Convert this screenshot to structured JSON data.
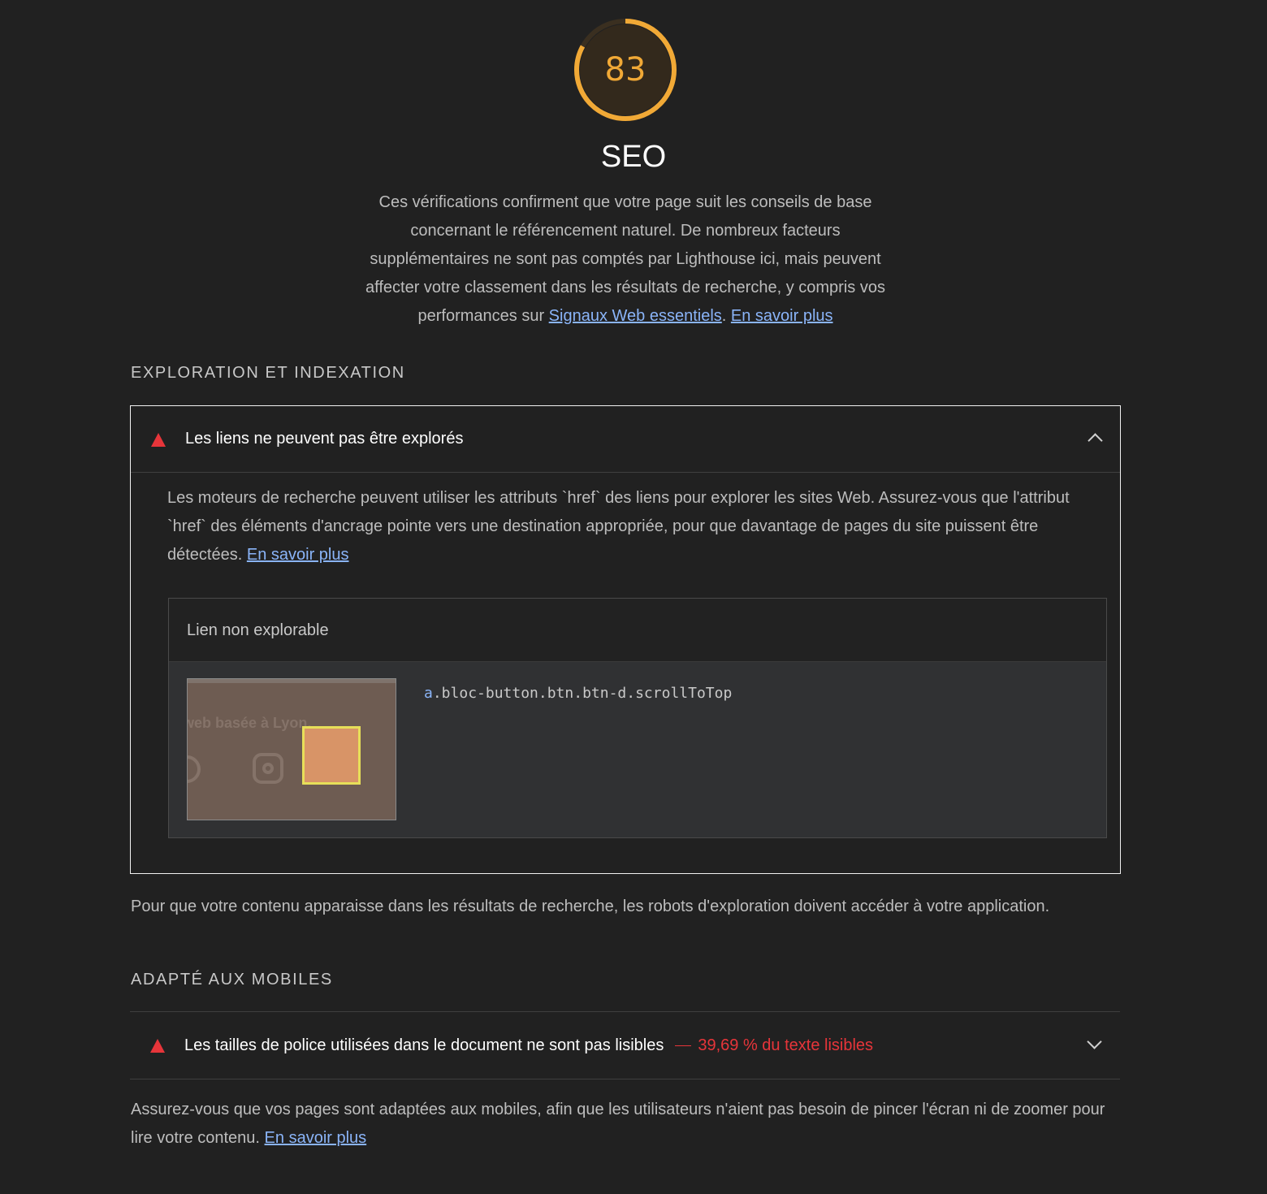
{
  "category": {
    "score": "83",
    "score_fraction": 0.83,
    "score_color": "#f1a936",
    "title": "SEO",
    "description_text": "Ces vérifications confirment que votre page suit les conseils de base concernant le référencement naturel. De nombreux facteurs supplémentaires ne sont pas comptés par Lighthouse ici, mais peuvent affecter votre classement dans les résultats de recherche, y compris vos performances sur",
    "cwv_link": "Signaux Web essentiels",
    "separator": ".",
    "learn_more": "En savoir plus"
  },
  "groups": {
    "crawl": {
      "title": "EXPLORATION ET INDEXATION",
      "audit": {
        "icon": "fail-triangle-icon",
        "title": "Les liens ne peuvent pas être explorés",
        "expanded": true,
        "description": "Les moteurs de recherche peuvent utiliser les attributs `href` des liens pour explorer les sites Web. Assurez-vous que l'attribut `href` des éléments d'ancrage pointe vers une destination appropriée, pour que davantage de pages du site puissent être détectées.",
        "learn_more": "En savoir plus",
        "table": {
          "column_header": "Lien non explorable",
          "rows": [
            {
              "thumbnail_text": "web basée à Lyon,",
              "selector_tag": "a",
              "selector_rest": ".bloc-button.btn.btn-d.scrollToTop"
            }
          ]
        }
      },
      "explanation": "Pour que votre contenu apparaisse dans les résultats de recherche, les robots d'exploration doivent accéder à votre application."
    },
    "mobile": {
      "title": "ADAPTÉ AUX MOBILES",
      "audit": {
        "icon": "fail-triangle-icon",
        "title": "Les tailles de police utilisées dans le document ne sont pas lisibles",
        "display_value": "39,69 % du texte lisibles",
        "expanded": false
      },
      "description": "Assurez-vous que vos pages sont adaptées aux mobiles, afin que les utilisateurs n'aient pas besoin de pincer l'écran ni de zoomer pour lire votre contenu.",
      "learn_more": "En savoir plus"
    }
  },
  "colors": {
    "background": "#212121",
    "fail": "#e7353a",
    "link": "#8ab4f8",
    "average": "#f1a936"
  }
}
